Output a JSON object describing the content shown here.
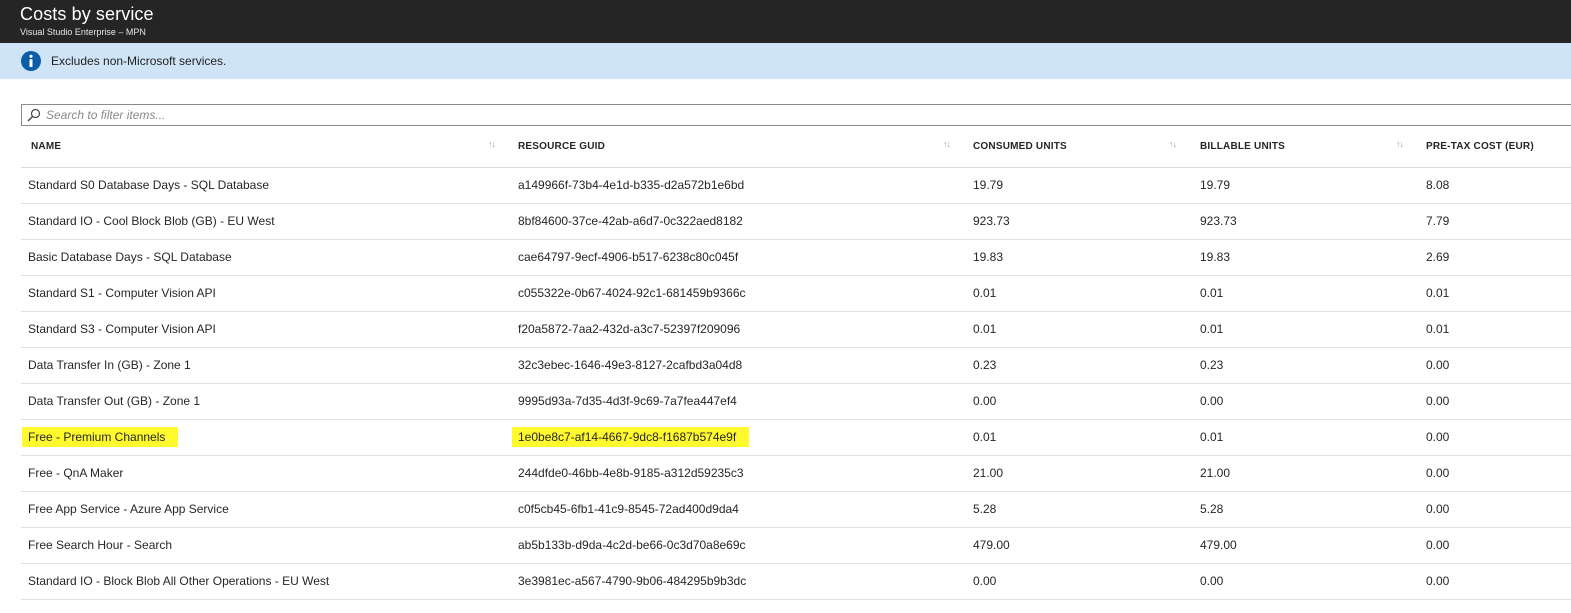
{
  "header": {
    "title": "Costs by service",
    "subtitle": "Visual Studio Enterprise – MPN"
  },
  "info": {
    "icon": "info-icon",
    "text": "Excludes non-Microsoft services.",
    "accent": "#0a5ea8"
  },
  "search": {
    "icon": "search-icon",
    "placeholder": "Search to filter items...",
    "value": ""
  },
  "table": {
    "columns": [
      {
        "label": "NAME",
        "sortable": true
      },
      {
        "label": "RESOURCE GUID",
        "sortable": true
      },
      {
        "label": "CONSUMED UNITS",
        "sortable": true
      },
      {
        "label": "BILLABLE UNITS",
        "sortable": true
      },
      {
        "label": "PRE-TAX COST (EUR)",
        "sortable": false
      }
    ],
    "highlight_color": "#fff92e",
    "rows": [
      {
        "name": "Standard S0 Database Days - SQL Database",
        "guid": "a149966f-73b4-4e1d-b335-d2a572b1e6bd",
        "consumed": "19.79",
        "billable": "19.79",
        "cost": "8.08",
        "highlighted": false
      },
      {
        "name": "Standard IO - Cool Block Blob (GB) - EU West",
        "guid": "8bf84600-37ce-42ab-a6d7-0c322aed8182",
        "consumed": "923.73",
        "billable": "923.73",
        "cost": "7.79",
        "highlighted": false
      },
      {
        "name": "Basic Database Days - SQL Database",
        "guid": "cae64797-9ecf-4906-b517-6238c80c045f",
        "consumed": "19.83",
        "billable": "19.83",
        "cost": "2.69",
        "highlighted": false
      },
      {
        "name": "Standard S1 - Computer Vision API",
        "guid": "c055322e-0b67-4024-92c1-681459b9366c",
        "consumed": "0.01",
        "billable": "0.01",
        "cost": "0.01",
        "highlighted": false
      },
      {
        "name": "Standard S3 - Computer Vision API",
        "guid": "f20a5872-7aa2-432d-a3c7-52397f209096",
        "consumed": "0.01",
        "billable": "0.01",
        "cost": "0.01",
        "highlighted": false
      },
      {
        "name": "Data Transfer In (GB) - Zone 1",
        "guid": "32c3ebec-1646-49e3-8127-2cafbd3a04d8",
        "consumed": "0.23",
        "billable": "0.23",
        "cost": "0.00",
        "highlighted": false
      },
      {
        "name": "Data Transfer Out (GB) - Zone 1",
        "guid": "9995d93a-7d35-4d3f-9c69-7a7fea447ef4",
        "consumed": "0.00",
        "billable": "0.00",
        "cost": "0.00",
        "highlighted": false
      },
      {
        "name": "Free - Premium Channels",
        "guid": "1e0be8c7-af14-4667-9dc8-f1687b574e9f",
        "consumed": "0.01",
        "billable": "0.01",
        "cost": "0.00",
        "highlighted": true
      },
      {
        "name": "Free - QnA Maker",
        "guid": "244dfde0-46bb-4e8b-9185-a312d59235c3",
        "consumed": "21.00",
        "billable": "21.00",
        "cost": "0.00",
        "highlighted": false
      },
      {
        "name": "Free App Service - Azure App Service",
        "guid": "c0f5cb45-6fb1-41c9-8545-72ad400d9da4",
        "consumed": "5.28",
        "billable": "5.28",
        "cost": "0.00",
        "highlighted": false
      },
      {
        "name": "Free Search Hour - Search",
        "guid": "ab5b133b-d9da-4c2d-be66-0c3d70a8e69c",
        "consumed": "479.00",
        "billable": "479.00",
        "cost": "0.00",
        "highlighted": false
      },
      {
        "name": "Standard IO - Block Blob All Other Operations - EU West",
        "guid": "3e3981ec-a567-4790-9b06-484295b9b3dc",
        "consumed": "0.00",
        "billable": "0.00",
        "cost": "0.00",
        "highlighted": false
      }
    ]
  }
}
